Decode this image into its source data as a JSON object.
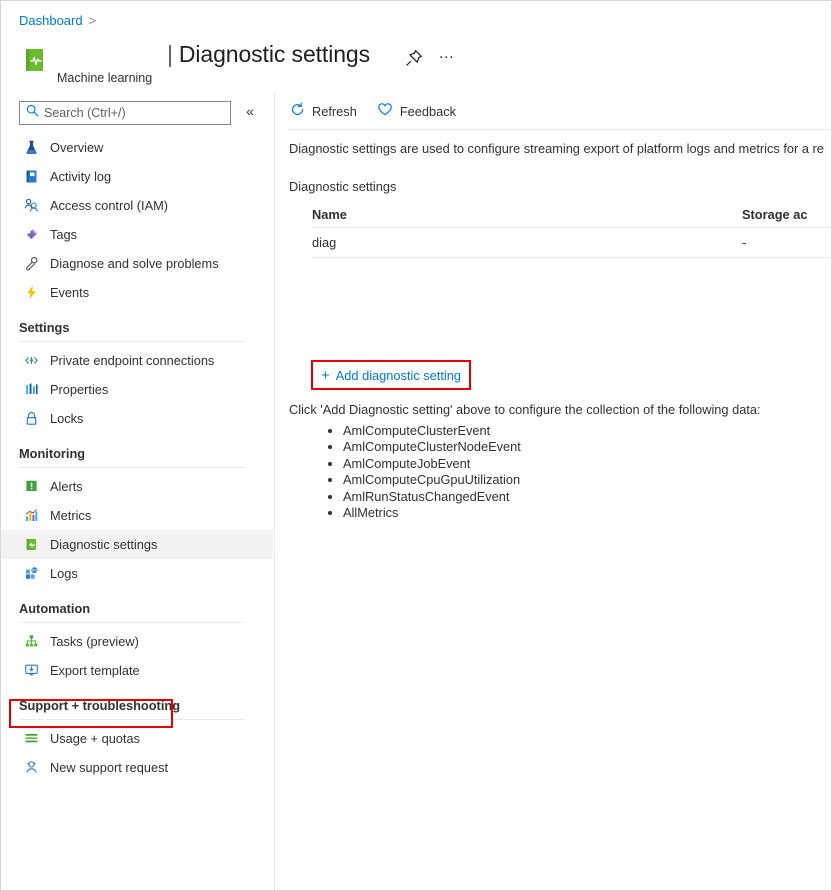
{
  "breadcrumb": {
    "root": "Dashboard",
    "separator": ">"
  },
  "resource": {
    "type_label": "Machine learning",
    "title_bar": "|",
    "title": "Diagnostic settings",
    "icon": "machine-learning-icon"
  },
  "header_actions": {
    "pin": "pin-icon",
    "more": "…"
  },
  "search": {
    "placeholder": "Search (Ctrl+/)",
    "value": "",
    "icon": "search-icon",
    "collapse": "«"
  },
  "sidebar": {
    "items": [
      {
        "label": "Overview",
        "icon": "flask-icon"
      },
      {
        "label": "Activity log",
        "icon": "activity-log-icon"
      },
      {
        "label": "Access control (IAM)",
        "icon": "people-icon"
      },
      {
        "label": "Tags",
        "icon": "tag-icon"
      },
      {
        "label": "Diagnose and solve problems",
        "icon": "wrench-icon"
      },
      {
        "label": "Events",
        "icon": "lightning-icon"
      }
    ],
    "groups": [
      {
        "title": "Settings",
        "items": [
          {
            "label": "Private endpoint connections",
            "icon": "private-endpoint-icon"
          },
          {
            "label": "Properties",
            "icon": "properties-icon"
          },
          {
            "label": "Locks",
            "icon": "lock-icon"
          }
        ]
      },
      {
        "title": "Monitoring",
        "items": [
          {
            "label": "Alerts",
            "icon": "alerts-icon"
          },
          {
            "label": "Metrics",
            "icon": "metrics-icon"
          },
          {
            "label": "Diagnostic settings",
            "icon": "diagnostic-settings-icon",
            "selected": true
          },
          {
            "label": "Logs",
            "icon": "logs-icon"
          }
        ]
      },
      {
        "title": "Automation",
        "items": [
          {
            "label": "Tasks (preview)",
            "icon": "tasks-icon"
          },
          {
            "label": "Export template",
            "icon": "export-template-icon"
          }
        ]
      },
      {
        "title": "Support + troubleshooting",
        "items": [
          {
            "label": "Usage + quotas",
            "icon": "usage-quotas-icon"
          },
          {
            "label": "New support request",
            "icon": "support-request-icon"
          }
        ]
      }
    ]
  },
  "toolbar": {
    "refresh_label": "Refresh",
    "refresh_icon": "refresh-icon",
    "feedback_label": "Feedback",
    "feedback_icon": "heart-icon"
  },
  "main": {
    "description": "Diagnostic settings are used to configure streaming export of platform logs and metrics for a re",
    "section_label": "Diagnostic settings",
    "table": {
      "columns": [
        "Name",
        "Storage ac"
      ],
      "rows": [
        {
          "name": "diag",
          "storage": "-"
        }
      ]
    },
    "add_setting": {
      "plus": "+",
      "label": "Add diagnostic setting"
    },
    "click_note": "Click 'Add Diagnostic setting' above to configure the collection of the following data:",
    "data_items": [
      "AmlComputeClusterEvent",
      "AmlComputeClusterNodeEvent",
      "AmlComputeJobEvent",
      "AmlComputeCpuGpuUtilization",
      "AmlRunStatusChangedEvent",
      "AllMetrics"
    ]
  },
  "colors": {
    "link": "#0078d4",
    "highlight": "#e00000",
    "selected_row": "#f3f2f1"
  }
}
